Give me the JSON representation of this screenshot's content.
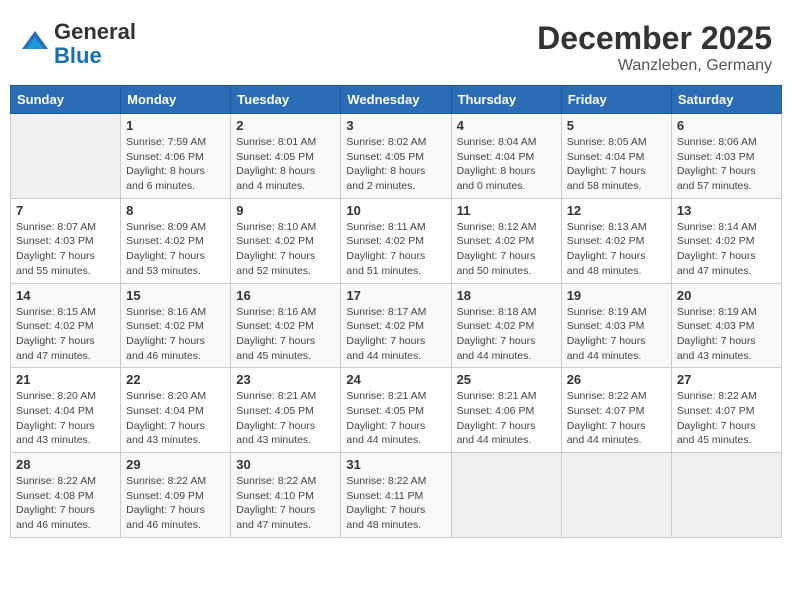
{
  "header": {
    "logo_general": "General",
    "logo_blue": "Blue",
    "month": "December 2025",
    "location": "Wanzleben, Germany"
  },
  "days_of_week": [
    "Sunday",
    "Monday",
    "Tuesday",
    "Wednesday",
    "Thursday",
    "Friday",
    "Saturday"
  ],
  "weeks": [
    [
      {
        "day": "",
        "sunrise": "",
        "sunset": "",
        "daylight": ""
      },
      {
        "day": "1",
        "sunrise": "Sunrise: 7:59 AM",
        "sunset": "Sunset: 4:06 PM",
        "daylight": "Daylight: 8 hours and 6 minutes."
      },
      {
        "day": "2",
        "sunrise": "Sunrise: 8:01 AM",
        "sunset": "Sunset: 4:05 PM",
        "daylight": "Daylight: 8 hours and 4 minutes."
      },
      {
        "day": "3",
        "sunrise": "Sunrise: 8:02 AM",
        "sunset": "Sunset: 4:05 PM",
        "daylight": "Daylight: 8 hours and 2 minutes."
      },
      {
        "day": "4",
        "sunrise": "Sunrise: 8:04 AM",
        "sunset": "Sunset: 4:04 PM",
        "daylight": "Daylight: 8 hours and 0 minutes."
      },
      {
        "day": "5",
        "sunrise": "Sunrise: 8:05 AM",
        "sunset": "Sunset: 4:04 PM",
        "daylight": "Daylight: 7 hours and 58 minutes."
      },
      {
        "day": "6",
        "sunrise": "Sunrise: 8:06 AM",
        "sunset": "Sunset: 4:03 PM",
        "daylight": "Daylight: 7 hours and 57 minutes."
      }
    ],
    [
      {
        "day": "7",
        "sunrise": "Sunrise: 8:07 AM",
        "sunset": "Sunset: 4:03 PM",
        "daylight": "Daylight: 7 hours and 55 minutes."
      },
      {
        "day": "8",
        "sunrise": "Sunrise: 8:09 AM",
        "sunset": "Sunset: 4:02 PM",
        "daylight": "Daylight: 7 hours and 53 minutes."
      },
      {
        "day": "9",
        "sunrise": "Sunrise: 8:10 AM",
        "sunset": "Sunset: 4:02 PM",
        "daylight": "Daylight: 7 hours and 52 minutes."
      },
      {
        "day": "10",
        "sunrise": "Sunrise: 8:11 AM",
        "sunset": "Sunset: 4:02 PM",
        "daylight": "Daylight: 7 hours and 51 minutes."
      },
      {
        "day": "11",
        "sunrise": "Sunrise: 8:12 AM",
        "sunset": "Sunset: 4:02 PM",
        "daylight": "Daylight: 7 hours and 50 minutes."
      },
      {
        "day": "12",
        "sunrise": "Sunrise: 8:13 AM",
        "sunset": "Sunset: 4:02 PM",
        "daylight": "Daylight: 7 hours and 48 minutes."
      },
      {
        "day": "13",
        "sunrise": "Sunrise: 8:14 AM",
        "sunset": "Sunset: 4:02 PM",
        "daylight": "Daylight: 7 hours and 47 minutes."
      }
    ],
    [
      {
        "day": "14",
        "sunrise": "Sunrise: 8:15 AM",
        "sunset": "Sunset: 4:02 PM",
        "daylight": "Daylight: 7 hours and 47 minutes."
      },
      {
        "day": "15",
        "sunrise": "Sunrise: 8:16 AM",
        "sunset": "Sunset: 4:02 PM",
        "daylight": "Daylight: 7 hours and 46 minutes."
      },
      {
        "day": "16",
        "sunrise": "Sunrise: 8:16 AM",
        "sunset": "Sunset: 4:02 PM",
        "daylight": "Daylight: 7 hours and 45 minutes."
      },
      {
        "day": "17",
        "sunrise": "Sunrise: 8:17 AM",
        "sunset": "Sunset: 4:02 PM",
        "daylight": "Daylight: 7 hours and 44 minutes."
      },
      {
        "day": "18",
        "sunrise": "Sunrise: 8:18 AM",
        "sunset": "Sunset: 4:02 PM",
        "daylight": "Daylight: 7 hours and 44 minutes."
      },
      {
        "day": "19",
        "sunrise": "Sunrise: 8:19 AM",
        "sunset": "Sunset: 4:03 PM",
        "daylight": "Daylight: 7 hours and 44 minutes."
      },
      {
        "day": "20",
        "sunrise": "Sunrise: 8:19 AM",
        "sunset": "Sunset: 4:03 PM",
        "daylight": "Daylight: 7 hours and 43 minutes."
      }
    ],
    [
      {
        "day": "21",
        "sunrise": "Sunrise: 8:20 AM",
        "sunset": "Sunset: 4:04 PM",
        "daylight": "Daylight: 7 hours and 43 minutes."
      },
      {
        "day": "22",
        "sunrise": "Sunrise: 8:20 AM",
        "sunset": "Sunset: 4:04 PM",
        "daylight": "Daylight: 7 hours and 43 minutes."
      },
      {
        "day": "23",
        "sunrise": "Sunrise: 8:21 AM",
        "sunset": "Sunset: 4:05 PM",
        "daylight": "Daylight: 7 hours and 43 minutes."
      },
      {
        "day": "24",
        "sunrise": "Sunrise: 8:21 AM",
        "sunset": "Sunset: 4:05 PM",
        "daylight": "Daylight: 7 hours and 44 minutes."
      },
      {
        "day": "25",
        "sunrise": "Sunrise: 8:21 AM",
        "sunset": "Sunset: 4:06 PM",
        "daylight": "Daylight: 7 hours and 44 minutes."
      },
      {
        "day": "26",
        "sunrise": "Sunrise: 8:22 AM",
        "sunset": "Sunset: 4:07 PM",
        "daylight": "Daylight: 7 hours and 44 minutes."
      },
      {
        "day": "27",
        "sunrise": "Sunrise: 8:22 AM",
        "sunset": "Sunset: 4:07 PM",
        "daylight": "Daylight: 7 hours and 45 minutes."
      }
    ],
    [
      {
        "day": "28",
        "sunrise": "Sunrise: 8:22 AM",
        "sunset": "Sunset: 4:08 PM",
        "daylight": "Daylight: 7 hours and 46 minutes."
      },
      {
        "day": "29",
        "sunrise": "Sunrise: 8:22 AM",
        "sunset": "Sunset: 4:09 PM",
        "daylight": "Daylight: 7 hours and 46 minutes."
      },
      {
        "day": "30",
        "sunrise": "Sunrise: 8:22 AM",
        "sunset": "Sunset: 4:10 PM",
        "daylight": "Daylight: 7 hours and 47 minutes."
      },
      {
        "day": "31",
        "sunrise": "Sunrise: 8:22 AM",
        "sunset": "Sunset: 4:11 PM",
        "daylight": "Daylight: 7 hours and 48 minutes."
      },
      {
        "day": "",
        "sunrise": "",
        "sunset": "",
        "daylight": ""
      },
      {
        "day": "",
        "sunrise": "",
        "sunset": "",
        "daylight": ""
      },
      {
        "day": "",
        "sunrise": "",
        "sunset": "",
        "daylight": ""
      }
    ]
  ]
}
